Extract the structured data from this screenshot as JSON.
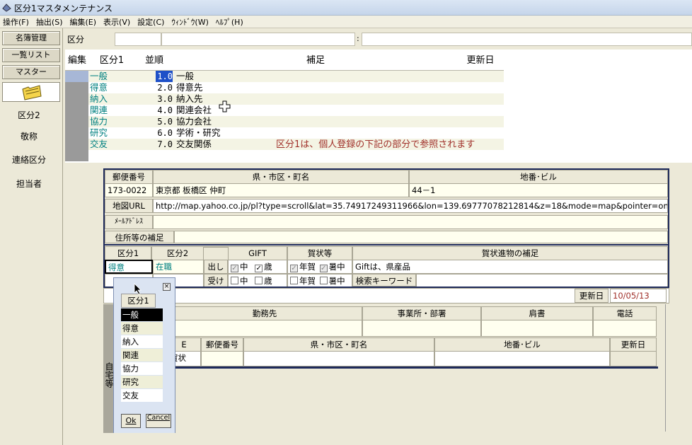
{
  "window": {
    "title": "区分1マスタメンテナンス"
  },
  "menu": [
    "操作(F)",
    "抽出(S)",
    "編集(E)",
    "表示(V)",
    "設定(C)",
    "ｳｨﾝﾄﾞｳ(W)",
    "ﾍﾙﾌﾟ(H)"
  ],
  "sidebar": {
    "buttons": [
      "名簿管理",
      "一覧リスト",
      "マスター"
    ],
    "links": [
      "区分2",
      "敬称",
      "連絡区分",
      "担当者"
    ]
  },
  "topbar": {
    "label": "区分",
    "colon": ":"
  },
  "grid": {
    "headers": [
      "編集",
      "区分1",
      "並順",
      "補足",
      "更新日"
    ],
    "rows": [
      {
        "kubun": "一般",
        "order": "1.0",
        "note": "一般"
      },
      {
        "kubun": "得意",
        "order": "2.0",
        "note": "得意先"
      },
      {
        "kubun": "納入",
        "order": "3.0",
        "note": "納入先"
      },
      {
        "kubun": "関連",
        "order": "4.0",
        "note": "関連会社"
      },
      {
        "kubun": "協力",
        "order": "5.0",
        "note": "協力会社"
      },
      {
        "kubun": "研究",
        "order": "6.0",
        "note": "学術・研究"
      },
      {
        "kubun": "交友",
        "order": "7.0",
        "note": "交友関係"
      }
    ]
  },
  "note": "区分1は、個人登録の下記の部分で参照されます",
  "detail": {
    "h_zip": "郵便番号",
    "h_pref": "県・市区・町名",
    "h_bldg": "地番･ビル",
    "zip": "173-0022",
    "pref": "東京都  板橋区  仲町",
    "bldg": "44－1",
    "map_label": "地図URL",
    "map_url": "http://map.yahoo.co.jp/pl?type=scroll&lat=35.74917249311966&lon=139.69777078212814&z=18&mode=map&pointer=on&datum=",
    "mail_label": "ﾒｰﾙｱﾄﾞﾚｽ",
    "addr_note_label": "住所等の補足",
    "h_k1": "区分1",
    "h_k2": "区分2",
    "h_gift": "GIFT",
    "h_greet": "賀状等",
    "h_extra": "賀状進物の補足",
    "k1_value": "得意",
    "k2_value": "在職",
    "out_label": "出し",
    "in_label": "受け",
    "opt_mid": "中",
    "opt_year": "歳",
    "opt_newyear": "年賀",
    "opt_summer": "暑中",
    "gift_note": "Giftは、県産品",
    "search_kw": "検索キーワード",
    "update_label": "更新日",
    "update_date": "10/05/13",
    "h_work": "勤務先",
    "h_dept": "事業所・部署",
    "h_title": "肩書",
    "h_tel": "電話",
    "h_zip2": "郵便番号",
    "h_pref2": "県・市区・町名",
    "h_bldg2": "地番･ビル",
    "h_upd2": "更新日",
    "side_label": "自宅等",
    "frag_re": "E",
    "frag_greet": "賀状"
  },
  "popup": {
    "title": "区分1",
    "items": [
      "一般",
      "得意",
      "納入",
      "関連",
      "協力",
      "研究",
      "交友"
    ],
    "ok": "Ok",
    "cancel": "Cancel"
  }
}
